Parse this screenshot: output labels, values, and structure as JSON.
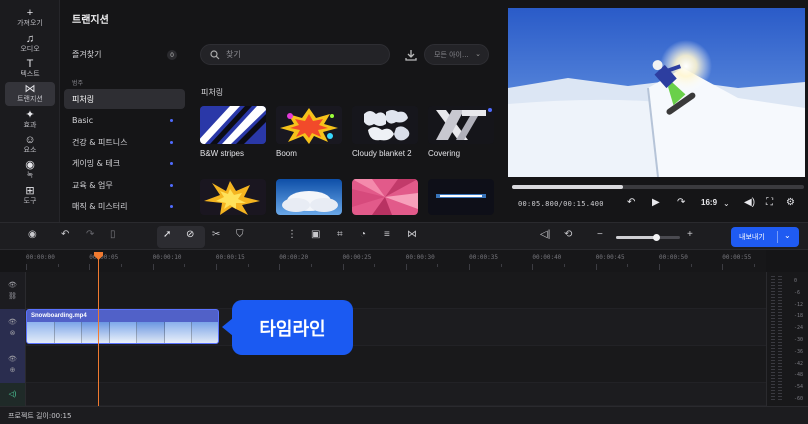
{
  "rail": [
    {
      "label": "가져오기",
      "icon": "plus-icon",
      "glyph": "+"
    },
    {
      "label": "오디오",
      "icon": "music-note-icon",
      "glyph": "♫"
    },
    {
      "label": "텍스트",
      "icon": "text-icon",
      "glyph": "T"
    },
    {
      "label": "트랜지션",
      "icon": "transition-icon",
      "glyph": "⋈"
    },
    {
      "label": "효과",
      "icon": "sparkle-icon",
      "glyph": "✦"
    },
    {
      "label": "요소",
      "icon": "sticker-icon",
      "glyph": "☺"
    },
    {
      "label": "녹",
      "icon": "record-icon",
      "glyph": "◉"
    },
    {
      "label": "도구",
      "icon": "grid-tools-icon",
      "glyph": "⊞"
    }
  ],
  "panel": {
    "title": "트랜지션",
    "favorites_label": "즐겨찾기",
    "favorites_count": "0",
    "section_label": "범주",
    "categories": [
      "피처링",
      "Basic",
      "건강 & 피트니스",
      "게이밍 & 테크",
      "교육 & 업무",
      "매직 & 미스터리"
    ],
    "active_category": "피처링"
  },
  "search": {
    "placeholder": "찾기"
  },
  "filter": {
    "label": "모든 아이..."
  },
  "grid": {
    "heading": "피처링",
    "tiles": [
      "B&W stripes",
      "Boom",
      "Cloudy blanket 2",
      "Covering"
    ]
  },
  "preview": {
    "timecode": "00:05.800/00:15.400",
    "progress": 0.38,
    "ratio": "16:9"
  },
  "toolbar": {
    "export_label": "내보내기",
    "zoom_level": 0.62
  },
  "ruler": {
    "labels": [
      "00:00:00",
      "00:00:05",
      "00:00:10",
      "00:00:15",
      "00:00:20",
      "00:00:25",
      "00:00:30",
      "00:00:35",
      "00:00:40",
      "00:00:45",
      "00:00:50",
      "00:00:55"
    ]
  },
  "clip": {
    "name": "Snowboarding.mp4"
  },
  "callout": {
    "text": "타임라인"
  },
  "meter": {
    "labels": [
      "0",
      "-6",
      "-12",
      "-18",
      "-24",
      "-30",
      "-36",
      "-42",
      "-48",
      "-54",
      "-60"
    ]
  },
  "status": {
    "text": "프로젝트 길이:00:15"
  },
  "colors": {
    "accent": "#1f5bf2",
    "playhead": "#f07a30",
    "clip": "#5161c8"
  }
}
